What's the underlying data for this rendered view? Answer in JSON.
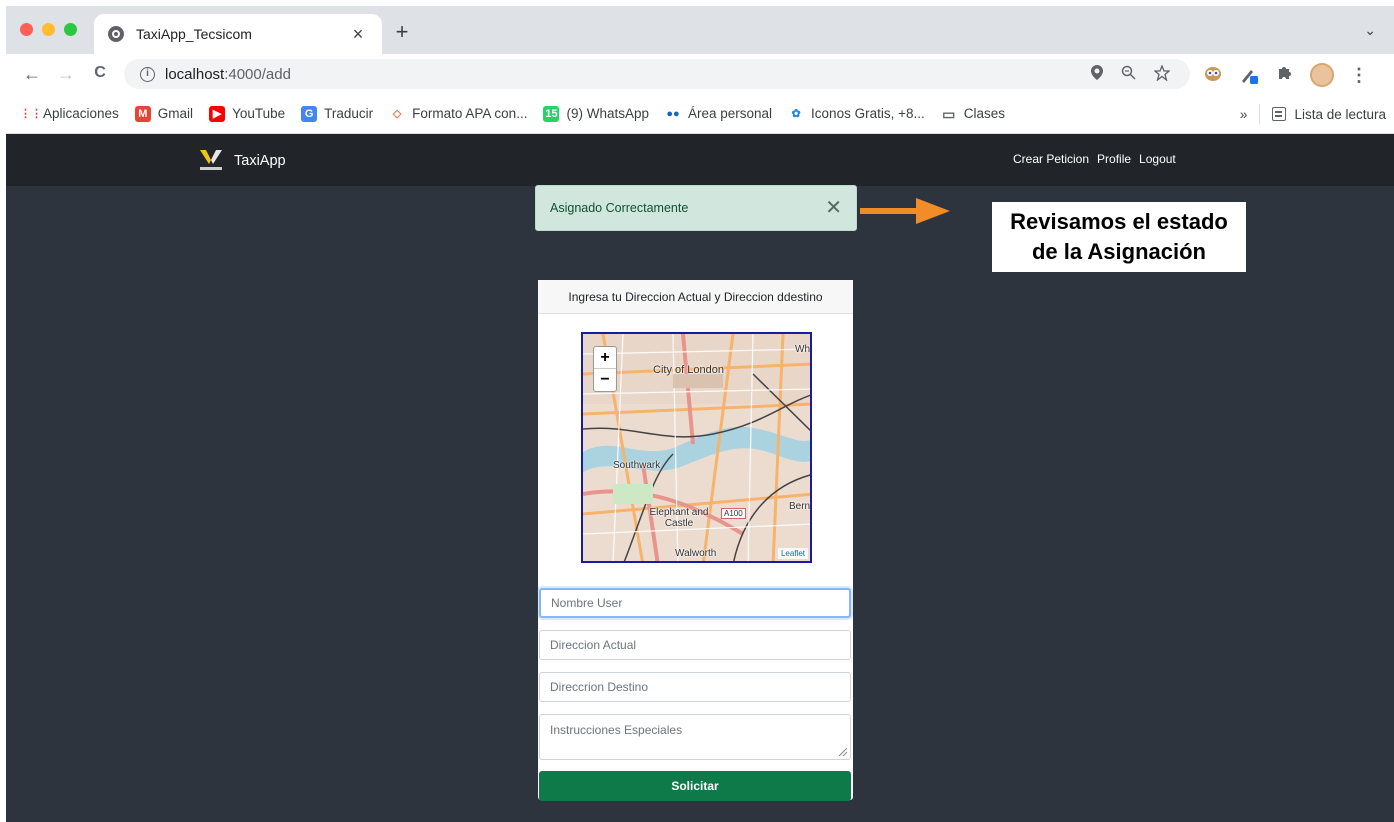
{
  "browser": {
    "tab_title": "TaxiApp_Tecsicom",
    "tab_close": "×",
    "new_tab": "+",
    "tab_menu": "⌄",
    "url_host": "localhost",
    "url_path": ":4000/add",
    "info_glyph": "i",
    "back": "←",
    "forward": "→",
    "reload": "C",
    "bookmarks": [
      {
        "label": "Aplicaciones",
        "icon": "apps-grid-icon",
        "glyph": "⋮⋮",
        "color": "#ea4335"
      },
      {
        "label": "Gmail",
        "icon": "gmail-icon",
        "glyph": "M",
        "color": "#ea4335"
      },
      {
        "label": "YouTube",
        "icon": "youtube-icon",
        "glyph": "▶",
        "color": "#ff0000"
      },
      {
        "label": "Traducir",
        "icon": "translate-icon",
        "glyph": "G",
        "color": "#4285f4"
      },
      {
        "label": "Formato APA con...",
        "icon": "apa-icon",
        "glyph": "◇",
        "color": "#ff7043"
      },
      {
        "label": "(9) WhatsApp",
        "icon": "whatsapp-icon",
        "glyph": "15",
        "color": "#25d366"
      },
      {
        "label": "Área personal",
        "icon": "moodle-icon",
        "glyph": "●●",
        "color": "#1565c0"
      },
      {
        "label": "Iconos Gratis, +8...",
        "icon": "icons-site-icon",
        "glyph": "✿",
        "color": "#1e88e5"
      },
      {
        "label": "Clases",
        "icon": "folder-icon",
        "glyph": "▭",
        "color": "#5f6368"
      }
    ],
    "more_bookmarks": "»",
    "reading_list": "Lista de lectura"
  },
  "navbar": {
    "brand": "TaxiApp",
    "links": [
      "Crear Peticion",
      "Profile",
      "Logout"
    ]
  },
  "alert": {
    "message": "Asignado Correctamente",
    "close": "✕"
  },
  "annotation": {
    "line1": "Revisamos el estado",
    "line2": "de la Asignación"
  },
  "form": {
    "header": "Ingresa tu Direccion Actual y Direccion ddestino",
    "map": {
      "zoom_in": "+",
      "zoom_out": "−",
      "labels": [
        "City of London",
        "Southwark",
        "Elephant and Castle",
        "Walworth",
        "A100",
        "Wh",
        "Bern"
      ],
      "attribution": "Leaflet"
    },
    "fields": [
      {
        "placeholder": "Nombre User"
      },
      {
        "placeholder": "Direccion Actual"
      },
      {
        "placeholder": "Direccrion Destino"
      },
      {
        "placeholder": "Instrucciones Especiales"
      }
    ],
    "submit": "Solicitar"
  },
  "colors": {
    "navbar_bg": "#212529",
    "page_bg": "#2d343e",
    "alert_bg": "#d1e7dd",
    "submit_bg": "#0e7a4a",
    "arrow": "#f28c28"
  }
}
